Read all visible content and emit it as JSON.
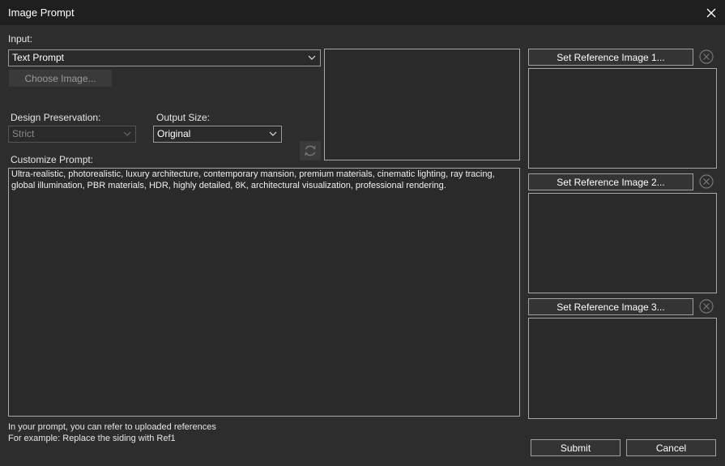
{
  "window": {
    "title": "Image Prompt"
  },
  "input": {
    "label": "Input:",
    "selected": "Text Prompt",
    "choose_image_label": "Choose Image..."
  },
  "design_preservation": {
    "label": "Design Preservation:",
    "selected": "Strict"
  },
  "output_size": {
    "label": "Output Size:",
    "selected": "Original"
  },
  "customize_prompt": {
    "label": "Customize Prompt:",
    "text": "Ultra-realistic, photorealistic, luxury architecture, contemporary mansion, premium materials, cinematic lighting, ray tracing, global illumination, PBR materials, HDR, highly detailed, 8K, architectural visualization, professional rendering."
  },
  "references": [
    {
      "button_label": "Set Reference Image 1..."
    },
    {
      "button_label": "Set Reference Image 2..."
    },
    {
      "button_label": "Set Reference Image 3..."
    }
  ],
  "hint": {
    "line1": "In your prompt, you can refer to uploaded references",
    "line2": "For example: Replace the siding with Ref1"
  },
  "footer": {
    "submit_label": "Submit",
    "cancel_label": "Cancel"
  },
  "icons": {
    "close": "close-icon",
    "dropdown": "chevron-down-icon",
    "refresh": "refresh-icon",
    "clear": "clear-circle-x-icon"
  },
  "colors": {
    "background": "#2d2d2d",
    "titlebar": "#1f1f1f",
    "field": "#2a2a2a",
    "border": "#a8a8a8"
  }
}
